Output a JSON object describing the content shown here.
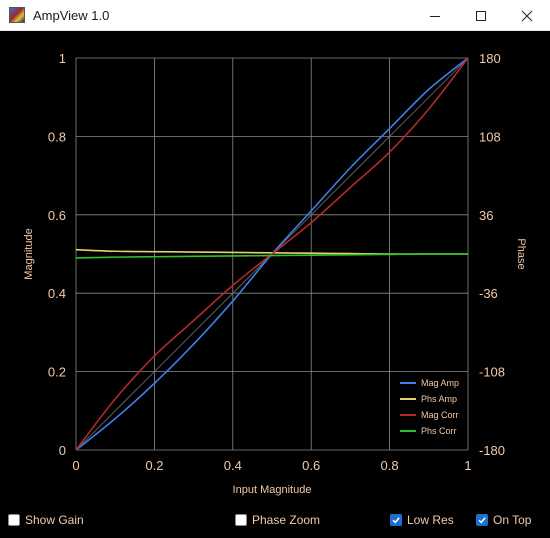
{
  "window": {
    "title": "AmpView 1.0",
    "app_icon": "ampview-app-icon",
    "buttons": [
      "minimize-icon",
      "maximize-icon",
      "close-icon"
    ]
  },
  "controls": {
    "show_gain": {
      "label": "Show Gain",
      "checked": false
    },
    "phase_zoom": {
      "label": "Phase Zoom",
      "checked": false
    },
    "low_res": {
      "label": "Low Res",
      "checked": true
    },
    "on_top": {
      "label": "On Top",
      "checked": true
    }
  },
  "colors": {
    "background": "#000000",
    "grid": "#8a8a8a",
    "text": "#f3c9a7",
    "checkbox_on": "#1f6fd1"
  },
  "chart_data": {
    "type": "line",
    "title": "",
    "xlabel": "Input Magnitude",
    "ylabel": "Magnitude",
    "y2label": "Phase",
    "xlim": [
      0,
      1
    ],
    "ylim": [
      0,
      1
    ],
    "y2lim": [
      -180,
      180
    ],
    "x_ticks": [
      "0",
      "0.2",
      "0.4",
      "0.6",
      "0.8",
      "1"
    ],
    "y_ticks": [
      "0",
      "0.2",
      "0.4",
      "0.6",
      "0.8",
      "1"
    ],
    "y2_ticks": [
      "-180",
      "-108",
      "-36",
      "36",
      "108",
      "180"
    ],
    "grid": true,
    "legend_position": "bottom-right",
    "reference_line": {
      "x": [
        0,
        1
      ],
      "y": [
        0,
        1
      ]
    },
    "series": [
      {
        "name": "Mag Amp",
        "color": "#3a82e8",
        "axis": "left",
        "x": [
          0,
          0.1,
          0.2,
          0.3,
          0.4,
          0.5,
          0.6,
          0.7,
          0.8,
          0.9,
          1.0
        ],
        "y": [
          0,
          0.08,
          0.17,
          0.27,
          0.38,
          0.5,
          0.61,
          0.72,
          0.82,
          0.92,
          1.0
        ]
      },
      {
        "name": "Phs Amp",
        "color": "#e8d264",
        "axis": "left",
        "x": [
          0,
          0.1,
          0.2,
          0.3,
          0.4,
          0.5,
          0.6,
          0.7,
          0.8,
          0.9,
          1.0
        ],
        "y": [
          0.511,
          0.507,
          0.506,
          0.505,
          0.504,
          0.503,
          0.502,
          0.501,
          0.5,
          0.5,
          0.5
        ]
      },
      {
        "name": "Mag Corr",
        "color": "#b02a2a",
        "axis": "left",
        "x": [
          0,
          0.1,
          0.2,
          0.3,
          0.4,
          0.5,
          0.6,
          0.7,
          0.8,
          0.9,
          1.0
        ],
        "y": [
          0,
          0.13,
          0.24,
          0.33,
          0.42,
          0.5,
          0.58,
          0.67,
          0.76,
          0.87,
          1.0
        ]
      },
      {
        "name": "Phs Corr",
        "color": "#2ec02e",
        "axis": "left",
        "x": [
          0,
          0.1,
          0.2,
          0.3,
          0.4,
          0.5,
          0.6,
          0.7,
          0.8,
          0.9,
          1.0
        ],
        "y": [
          0.49,
          0.492,
          0.493,
          0.494,
          0.495,
          0.496,
          0.497,
          0.498,
          0.499,
          0.5,
          0.5
        ]
      }
    ]
  }
}
